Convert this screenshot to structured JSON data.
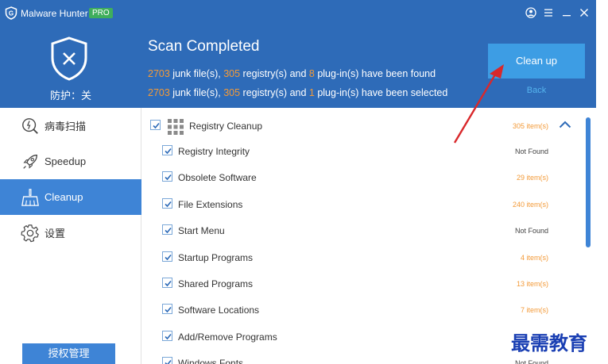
{
  "app": {
    "name": "Malware Hunter",
    "badge": "PRO"
  },
  "window_controls": [
    "user-icon",
    "menu-icon",
    "minimize-icon",
    "close-icon"
  ],
  "status": {
    "protection_label": "防护：关"
  },
  "scan": {
    "title": "Scan Completed",
    "found_line": {
      "junk_count": "2703",
      "junk_text": " junk file(s), ",
      "registry_count": "305",
      "registry_text": " registry(s) and ",
      "plugin_count": "8",
      "plugin_text": " plug-in(s) have been found"
    },
    "selected_line": {
      "junk_count": "2703",
      "junk_text": " junk file(s), ",
      "registry_count": "305",
      "registry_text": " registry(s) and ",
      "plugin_count": "1",
      "plugin_text": " plug-in(s) have been selected"
    },
    "cleanup_button": "Clean up",
    "back_link": "Back"
  },
  "sidebar": {
    "items": [
      {
        "label": "病毒扫描",
        "icon": "virus-scan-icon",
        "active": false
      },
      {
        "label": "Speedup",
        "icon": "rocket-icon",
        "active": false
      },
      {
        "label": "Cleanup",
        "icon": "broom-icon",
        "active": true
      },
      {
        "label": "设置",
        "icon": "gear-icon",
        "active": false
      }
    ],
    "license_button": "授权管理"
  },
  "list": {
    "group": {
      "label": "Registry Cleanup",
      "count": "305 item(s)",
      "checked": true
    },
    "items": [
      {
        "label": "Registry Integrity",
        "count": "Not Found",
        "checked": true
      },
      {
        "label": "Obsolete Software",
        "count": "29 item(s)",
        "checked": true
      },
      {
        "label": "File Extensions",
        "count": "240 item(s)",
        "checked": true
      },
      {
        "label": "Start Menu",
        "count": "Not Found",
        "checked": true
      },
      {
        "label": "Startup Programs",
        "count": "4 item(s)",
        "checked": true
      },
      {
        "label": "Shared Programs",
        "count": "13 item(s)",
        "checked": true
      },
      {
        "label": "Software Locations",
        "count": "7 item(s)",
        "checked": true
      },
      {
        "label": "Add/Remove Programs",
        "count": "",
        "checked": true
      },
      {
        "label": "Windows Fonts",
        "count": "Not Found",
        "checked": true
      }
    ]
  },
  "watermark": "最需教育",
  "colors": {
    "header_bg": "#2e6bb8",
    "accent": "#3e84d6",
    "highlight_count": "#f39a38",
    "cleanup_button": "#3d9de4",
    "annotation_arrow": "#d9282b"
  }
}
